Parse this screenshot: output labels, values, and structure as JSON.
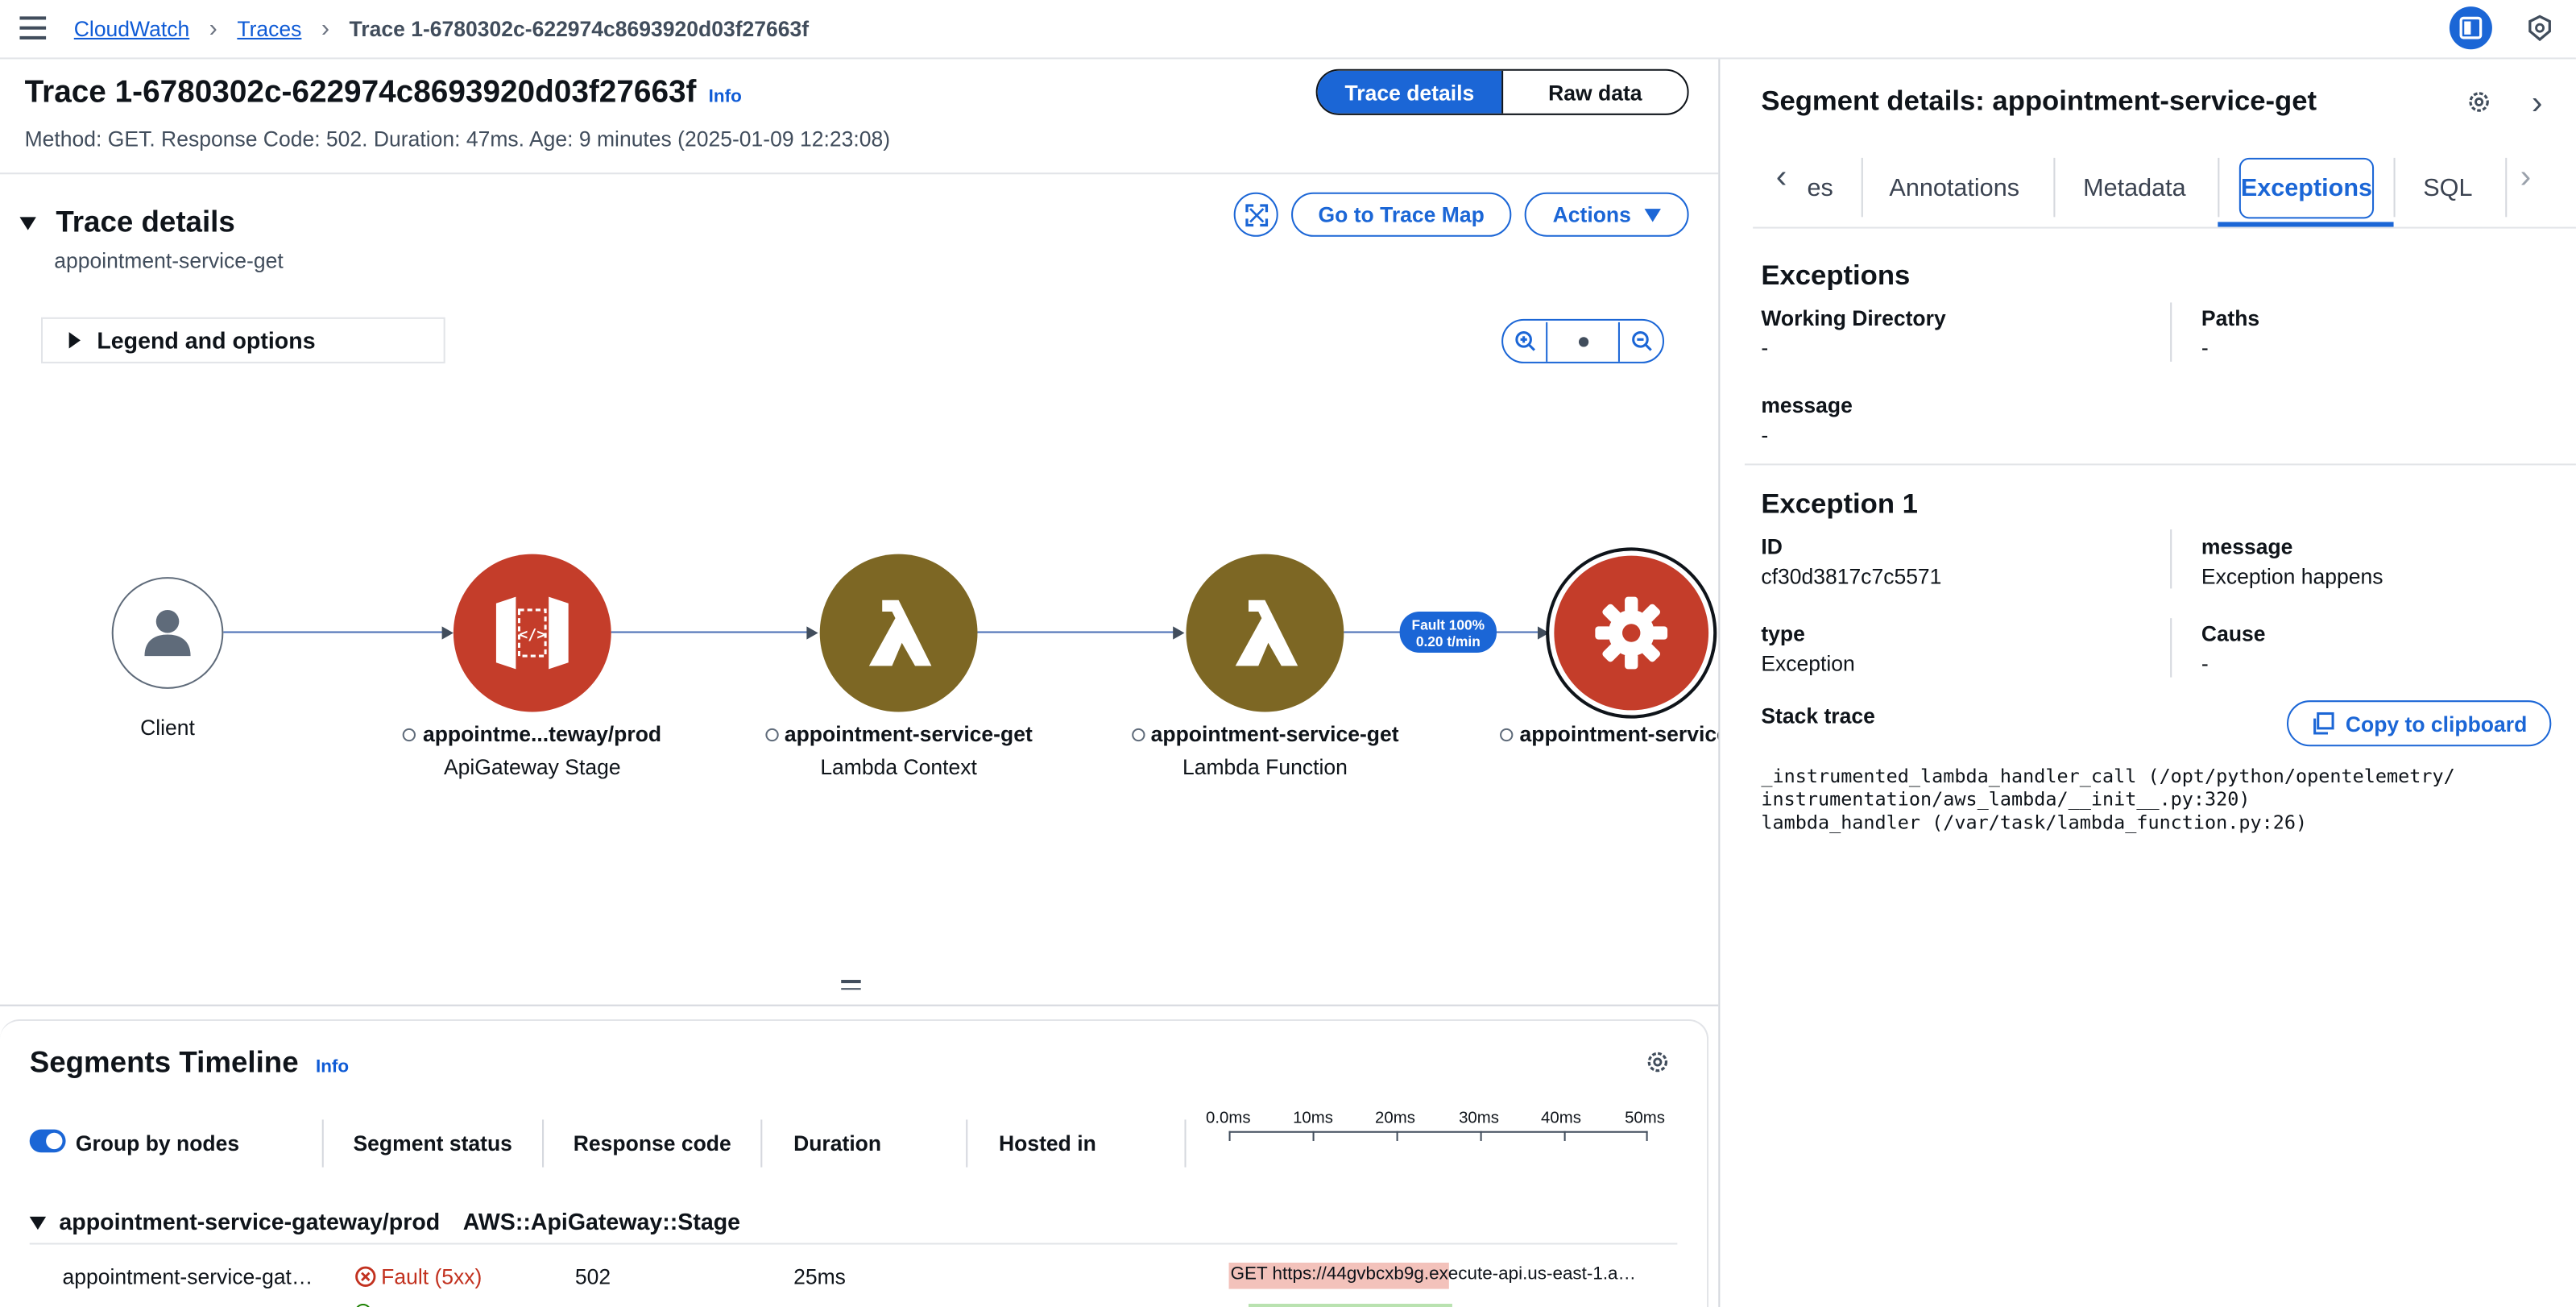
{
  "nav": {
    "breadcrumbs": [
      "CloudWatch",
      "Traces",
      "Trace 1-6780302c-622974c8693920d03f27663f"
    ]
  },
  "header": {
    "title": "Trace 1-6780302c-622974c8693920d03f27663f",
    "info_label": "Info",
    "subtitle": "Method: GET. Response Code: 502. Duration: 47ms. Age: 9 minutes (2025-01-09 12:23:08)",
    "view_toggle": [
      "Trace details",
      "Raw data"
    ]
  },
  "trace_details": {
    "heading": "Trace details",
    "subheading": "appointment-service-get",
    "go_to_map_label": "Go to Trace Map",
    "actions_label": "Actions",
    "legend_label": "Legend and options"
  },
  "graph": {
    "nodes": [
      {
        "title": "Client",
        "subtitle": "",
        "icon": "person-icon",
        "color": "#ffffff"
      },
      {
        "title": "appointme...teway/prod",
        "subtitle": "ApiGateway Stage",
        "icon": "api-gateway-icon",
        "color": "#c43d2a"
      },
      {
        "title": "appointment-service-get",
        "subtitle": "Lambda Context",
        "icon": "lambda-icon",
        "color": "#7d6724"
      },
      {
        "title": "appointment-service-get",
        "subtitle": "Lambda Function",
        "icon": "lambda-icon",
        "color": "#7d6724"
      },
      {
        "title": "appointment-service",
        "subtitle": "",
        "icon": "gear-icon",
        "color": "#c43d2a"
      }
    ],
    "edge_badge": [
      "Fault 100%",
      "0.20 t/min"
    ]
  },
  "timeline": {
    "title": "Segments Timeline",
    "info_label": "Info",
    "columns": [
      "Group by nodes",
      "Segment status",
      "Response code",
      "Duration",
      "Hosted in"
    ],
    "ticks": [
      "0.0ms",
      "10ms",
      "20ms",
      "30ms",
      "40ms",
      "50ms"
    ],
    "group": {
      "name": "appointment-service-gateway/prod",
      "type": "AWS::ApiGateway::Stage"
    },
    "rows": [
      {
        "name": "appointment-service-gat…",
        "status": "Fault (5xx)",
        "code": "502",
        "duration": "25ms",
        "bar_label": "GET https://44gvbcxb9g.execute-api.us-east-1.a…"
      }
    ]
  },
  "segment_panel": {
    "title": "Segment details: appointment-service-get",
    "tabs": [
      "es",
      "Annotations",
      "Metadata",
      "Exceptions",
      "SQL"
    ],
    "active_tab": "Exceptions",
    "exceptions_heading": "Exceptions",
    "working_directory": {
      "key": "Working Directory",
      "value": "-"
    },
    "paths": {
      "key": "Paths",
      "value": "-"
    },
    "message": {
      "key": "message",
      "value": "-"
    },
    "exception1": {
      "heading": "Exception 1",
      "id": {
        "key": "ID",
        "value": "cf30d3817c7c5571"
      },
      "message": {
        "key": "message",
        "value": "Exception happens"
      },
      "type": {
        "key": "type",
        "value": "Exception"
      },
      "cause": {
        "key": "Cause",
        "value": "-"
      },
      "stack_trace_label": "Stack trace",
      "copy_label": "Copy to clipboard",
      "stack_trace": "_instrumented_lambda_handler_call (/opt/python/opentelemetry/\ninstrumentation/aws_lambda/__init__.py:320)\nlambda_handler (/var/task/lambda_function.py:26)"
    }
  },
  "colors": {
    "accent": "#1b66d6",
    "fault_red": "#c43d2a",
    "lambda_olive": "#7d6724",
    "fault_text": "#c2311f"
  }
}
